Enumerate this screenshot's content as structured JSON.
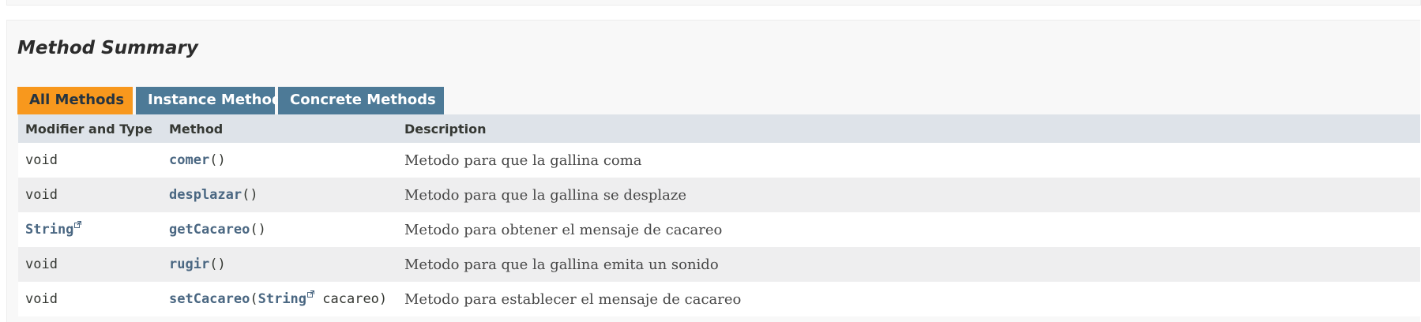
{
  "summary": {
    "title": "Method Summary"
  },
  "tabs": [
    {
      "label": "All Methods",
      "active": true
    },
    {
      "label": "Instance Methods",
      "active": false
    },
    {
      "label": "Concrete Methods",
      "active": false
    }
  ],
  "table": {
    "headers": [
      "Modifier and Type",
      "Method",
      "Description"
    ],
    "rows": [
      {
        "type": "void",
        "method": "comer",
        "params_open": "(",
        "param_type": "",
        "param_name": "",
        "params_close": ")",
        "description": "Metodo para que la gallina coma"
      },
      {
        "type": "void",
        "method": "desplazar",
        "params_open": "(",
        "param_type": "",
        "param_name": "",
        "params_close": ")",
        "description": "Metodo para que la gallina se desplaze"
      },
      {
        "type": "String",
        "method": "getCacareo",
        "params_open": "(",
        "param_type": "",
        "param_name": "",
        "params_close": ")",
        "description": "Metodo para obtener el mensaje de cacareo"
      },
      {
        "type": "void",
        "method": "rugir",
        "params_open": "(",
        "param_type": "",
        "param_name": "",
        "params_close": ")",
        "description": "Metodo para que la gallina emita un sonido"
      },
      {
        "type": "void",
        "method": "setCacareo",
        "params_open": "(",
        "param_type": "String",
        "param_name": " cacareo",
        "params_close": ")",
        "description": "Metodo para establecer el mensaje de cacareo"
      }
    ]
  },
  "colors": {
    "active_tab": "#f8981d",
    "inactive_tab": "#4d7a97",
    "header_bg": "#dee3e9",
    "link": "#4a6782"
  },
  "icons": {
    "external_link": "external-link-icon"
  }
}
